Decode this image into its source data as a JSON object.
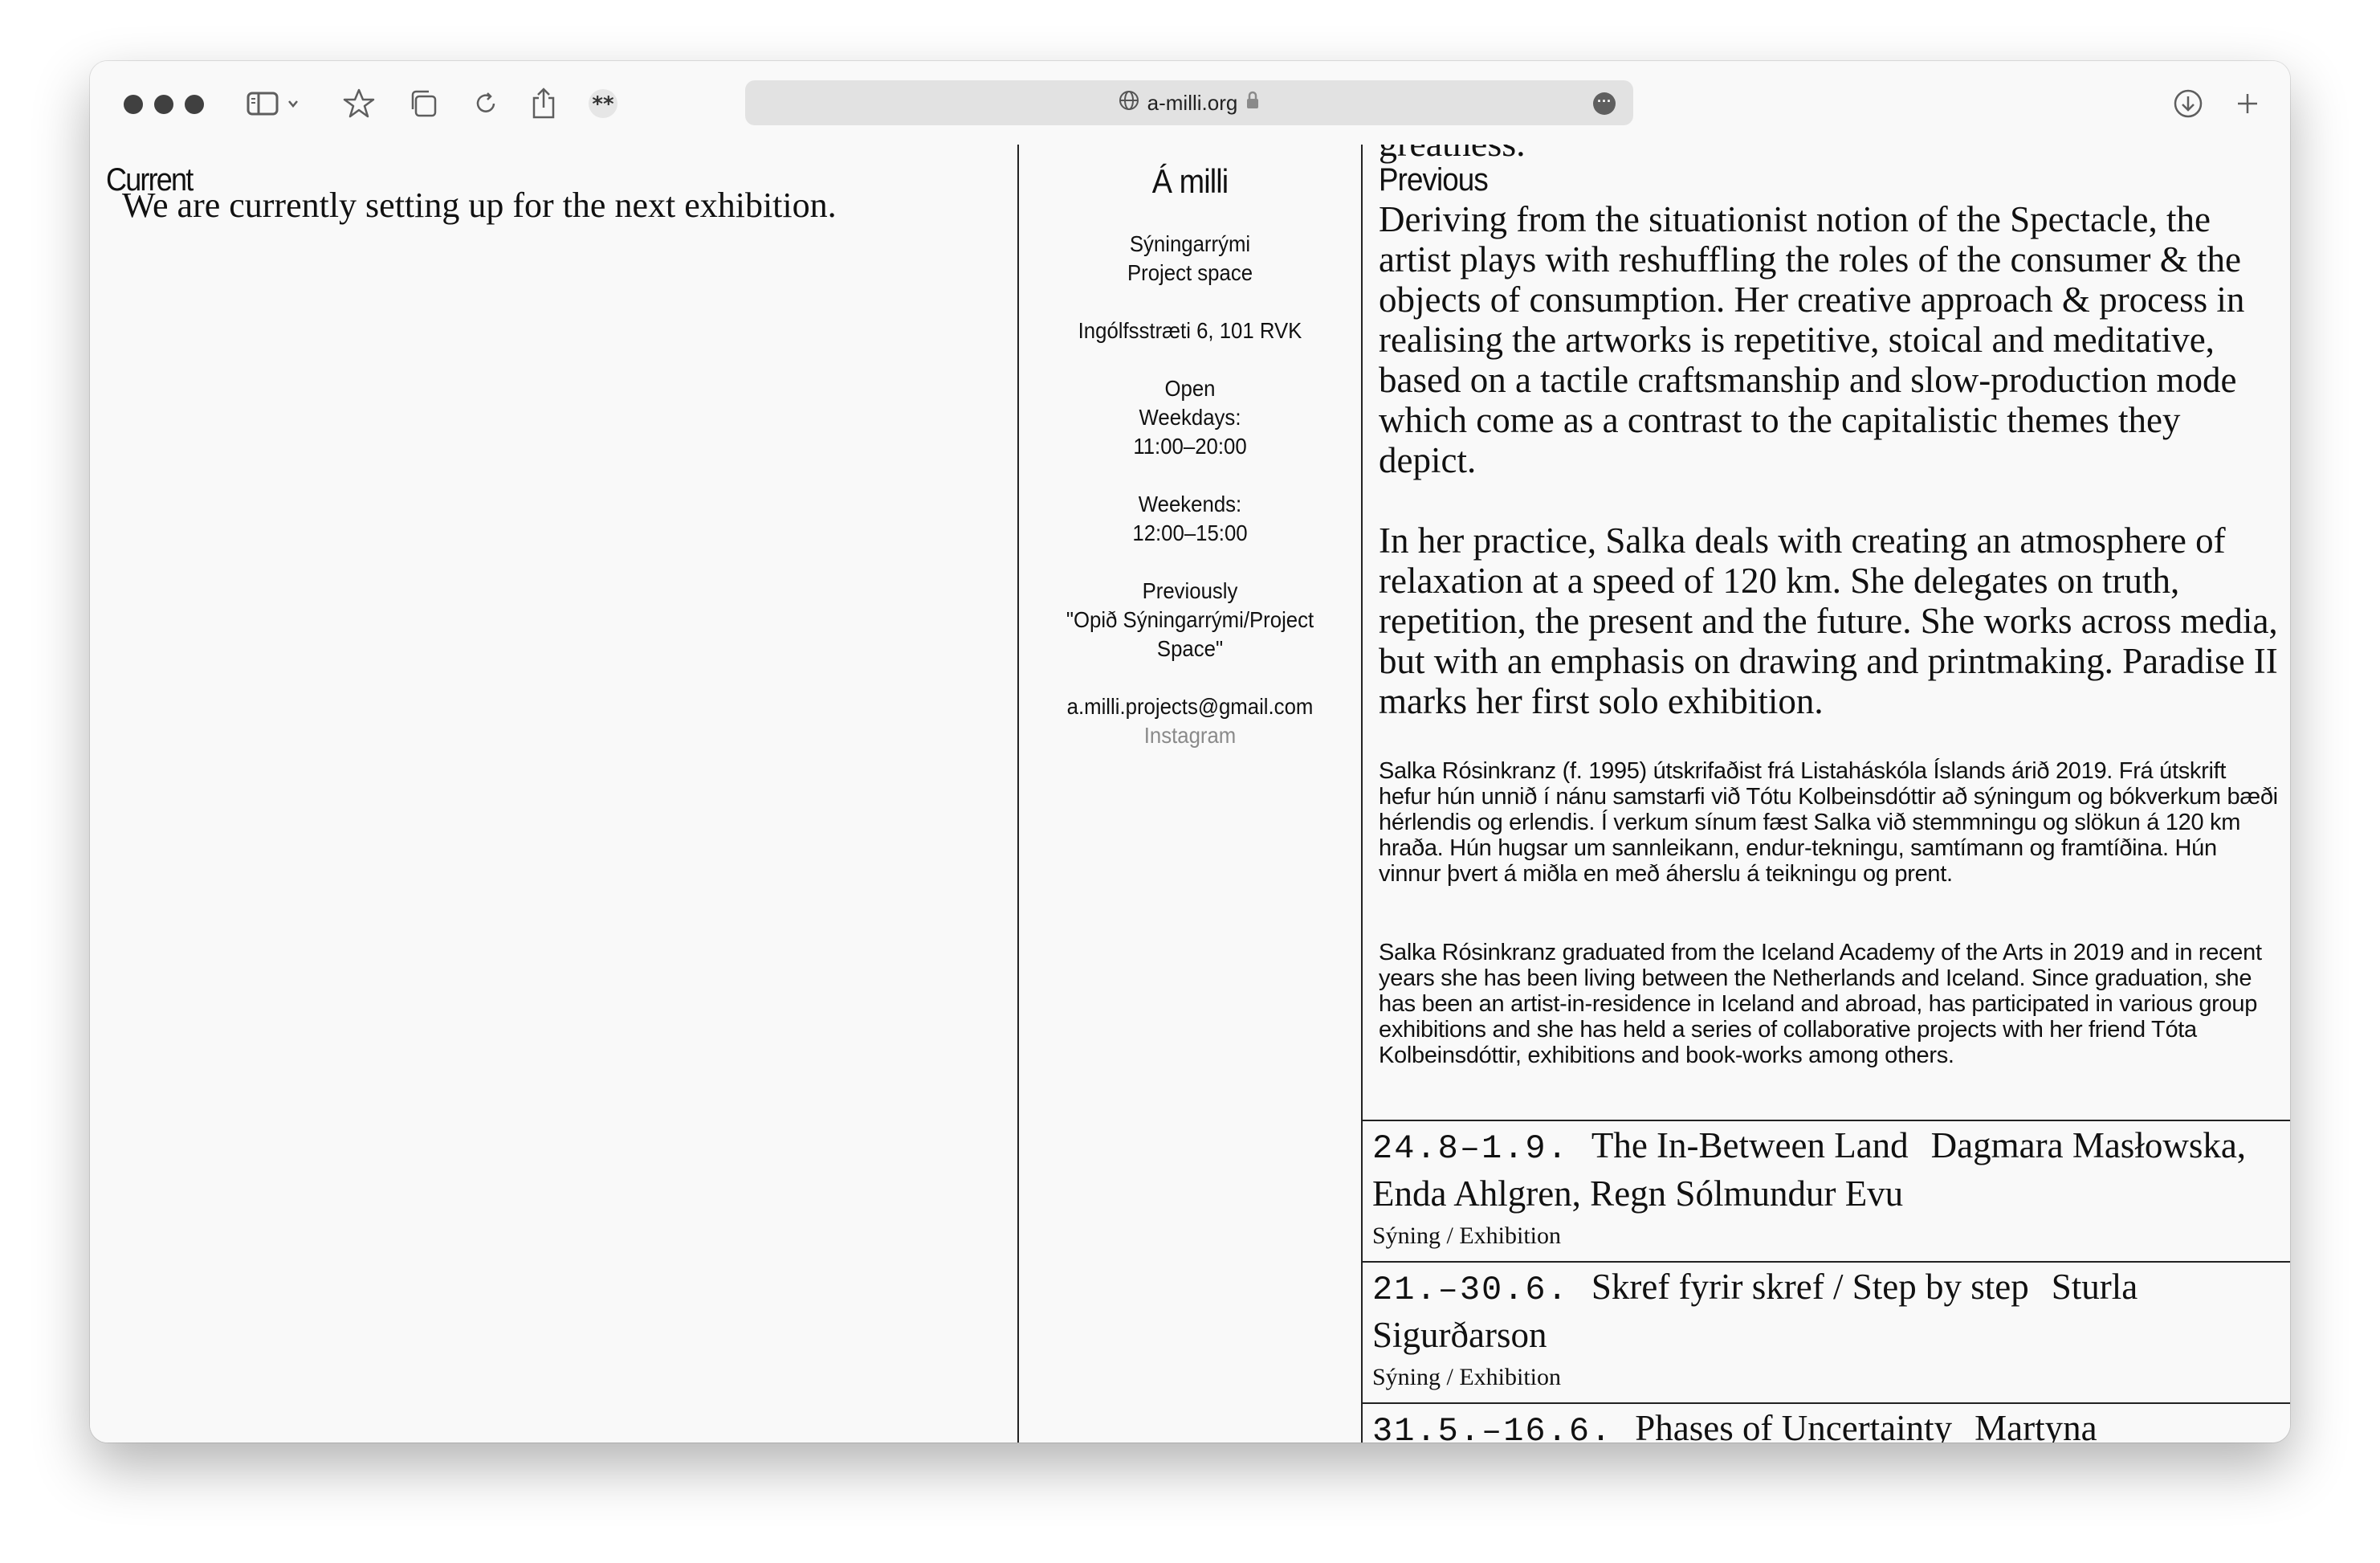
{
  "browser": {
    "url": "a-milli.org"
  },
  "current": {
    "heading": "Current",
    "text": "We are currently setting up for the next exhibition."
  },
  "info": {
    "title": "Á milli",
    "type_is": "Sýningarrými",
    "type_en": "Project space",
    "address": "Ingólfsstræti 6, 101 RVK",
    "open_label": "Open",
    "weekdays_label": "Weekdays:",
    "weekdays_hours": "11:00–20:00",
    "weekends_label": "Weekends:",
    "weekends_hours": "12:00–15:00",
    "previously_label": "Previously",
    "previously_name": "\"Opið Sýningarrými/Project Space\"",
    "email": "a.milli.projects@gmail.com",
    "instagram": "Instagram"
  },
  "previous": {
    "cut_text": "greatness.",
    "heading": "Previous",
    "para1": "Deriving from the situationist notion of the Spectacle, the artist plays with reshuffling the roles of the consumer & the objects of consumption. Her creative approach & process in realising the artworks is repetitive, stoical and meditative, based on a tactile craftsmanship and slow-production mode which come as a contrast to the capitalistic themes they depict.",
    "para2": "In her practice, Salka deals with creating an atmosphere of relaxation at a speed of 120 km. She delegates on truth, repetition, the present and the future. She works across media, but with an emphasis on drawing and printmaking. Paradise II marks her first solo exhibition.",
    "bio_is": "Salka Rósinkranz (f. 1995) útskrifaðist frá Listaháskóla Íslands árið 2019. Frá útskrift hefur hún unnið í nánu samstarfi við Tótu Kolbeinsdóttir að sýningum og bókverkum bæði hérlendis og erlendis. Í verkum sínum fæst Salka við stemmningu og slökun á 120 km hraða. Hún hugsar um sannleikann, endur-tekningu, samtímann og framtíðina. Hún vinnur þvert á miðla en með áherslu á teikningu og prent.",
    "bio_en": "Salka Rósinkranz graduated from the Iceland Academy of the Arts in 2019 and in recent years she has been living between the Netherlands and Iceland. Since graduation, she has been an artist-in-residence in Iceland and abroad, has participated in various group exhibitions and she has held a series of collaborative projects with her friend Tóta Kolbeinsdóttir, exhibitions and book-works among others."
  },
  "exhibitions": [
    {
      "date": "24.8–1.9.",
      "title": "The In-Between Land",
      "artists": "Dagmara Masłowska, Enda Ahlgren, Regn Sólmundur Evu",
      "kind": "Sýning / Exhibition"
    },
    {
      "date": "21.–30.6.",
      "title": "Skref fyrir skref / Step by step",
      "artists": "Sturla Sigurðarson",
      "kind": "Sýning / Exhibition"
    },
    {
      "date": "31.5.–16.6.",
      "title": "Phases of Uncertainty",
      "artists": "Martyna",
      "kind": ""
    }
  ]
}
